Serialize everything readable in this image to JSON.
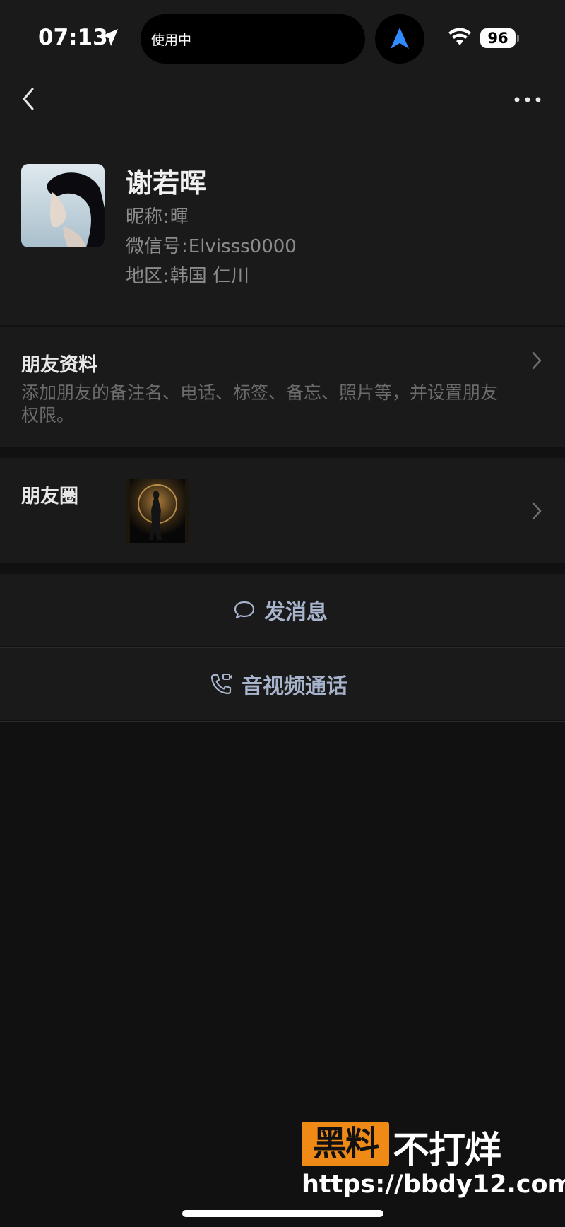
{
  "status_bar": {
    "time": "07:13",
    "island_text": "使用中",
    "battery": "96"
  },
  "profile": {
    "name": "谢若晖",
    "nickname_label": "昵称",
    "nickname": "暉",
    "wechat_id_label": "微信号",
    "wechat_id": "Elvisss0000",
    "region_label": "地区",
    "region": "韩国 仁川"
  },
  "friend_info": {
    "title": "朋友资料",
    "description": "添加朋友的备注名、电话、标签、备忘、照片等，并设置朋友权限。"
  },
  "moments": {
    "title": "朋友圈"
  },
  "actions": {
    "message": "发消息",
    "call": "音视频通话"
  },
  "watermark": {
    "badge": "黑料",
    "text": "不打烊",
    "url": "https://bbdy12.com"
  }
}
